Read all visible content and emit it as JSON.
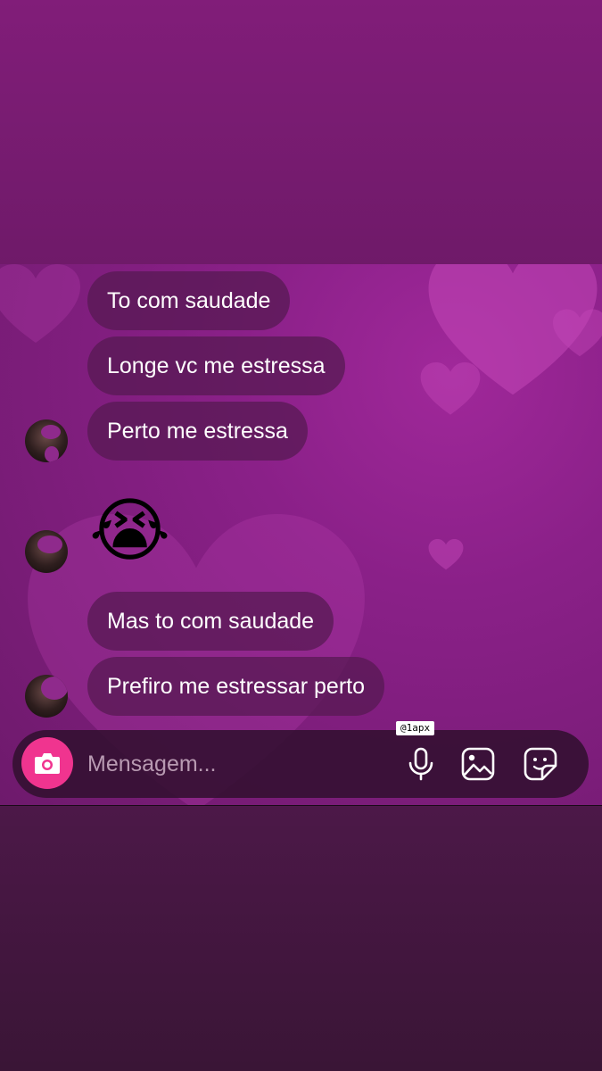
{
  "messages": [
    {
      "text": "To com saudade"
    },
    {
      "text": "Longe vc me estressa"
    },
    {
      "text": "Perto me estressa"
    },
    {
      "emoji": "😭"
    },
    {
      "text": "Mas to com saudade"
    },
    {
      "text": "Prefiro me estressar perto"
    }
  ],
  "composer": {
    "placeholder": "Mensagem...",
    "icons": [
      "camera-icon",
      "microphone-icon",
      "gallery-icon",
      "sticker-icon"
    ]
  },
  "watermark": "@1apx",
  "colors": {
    "accent": "#f0348f",
    "bubble": "#551950",
    "background": "#7d1c74"
  }
}
